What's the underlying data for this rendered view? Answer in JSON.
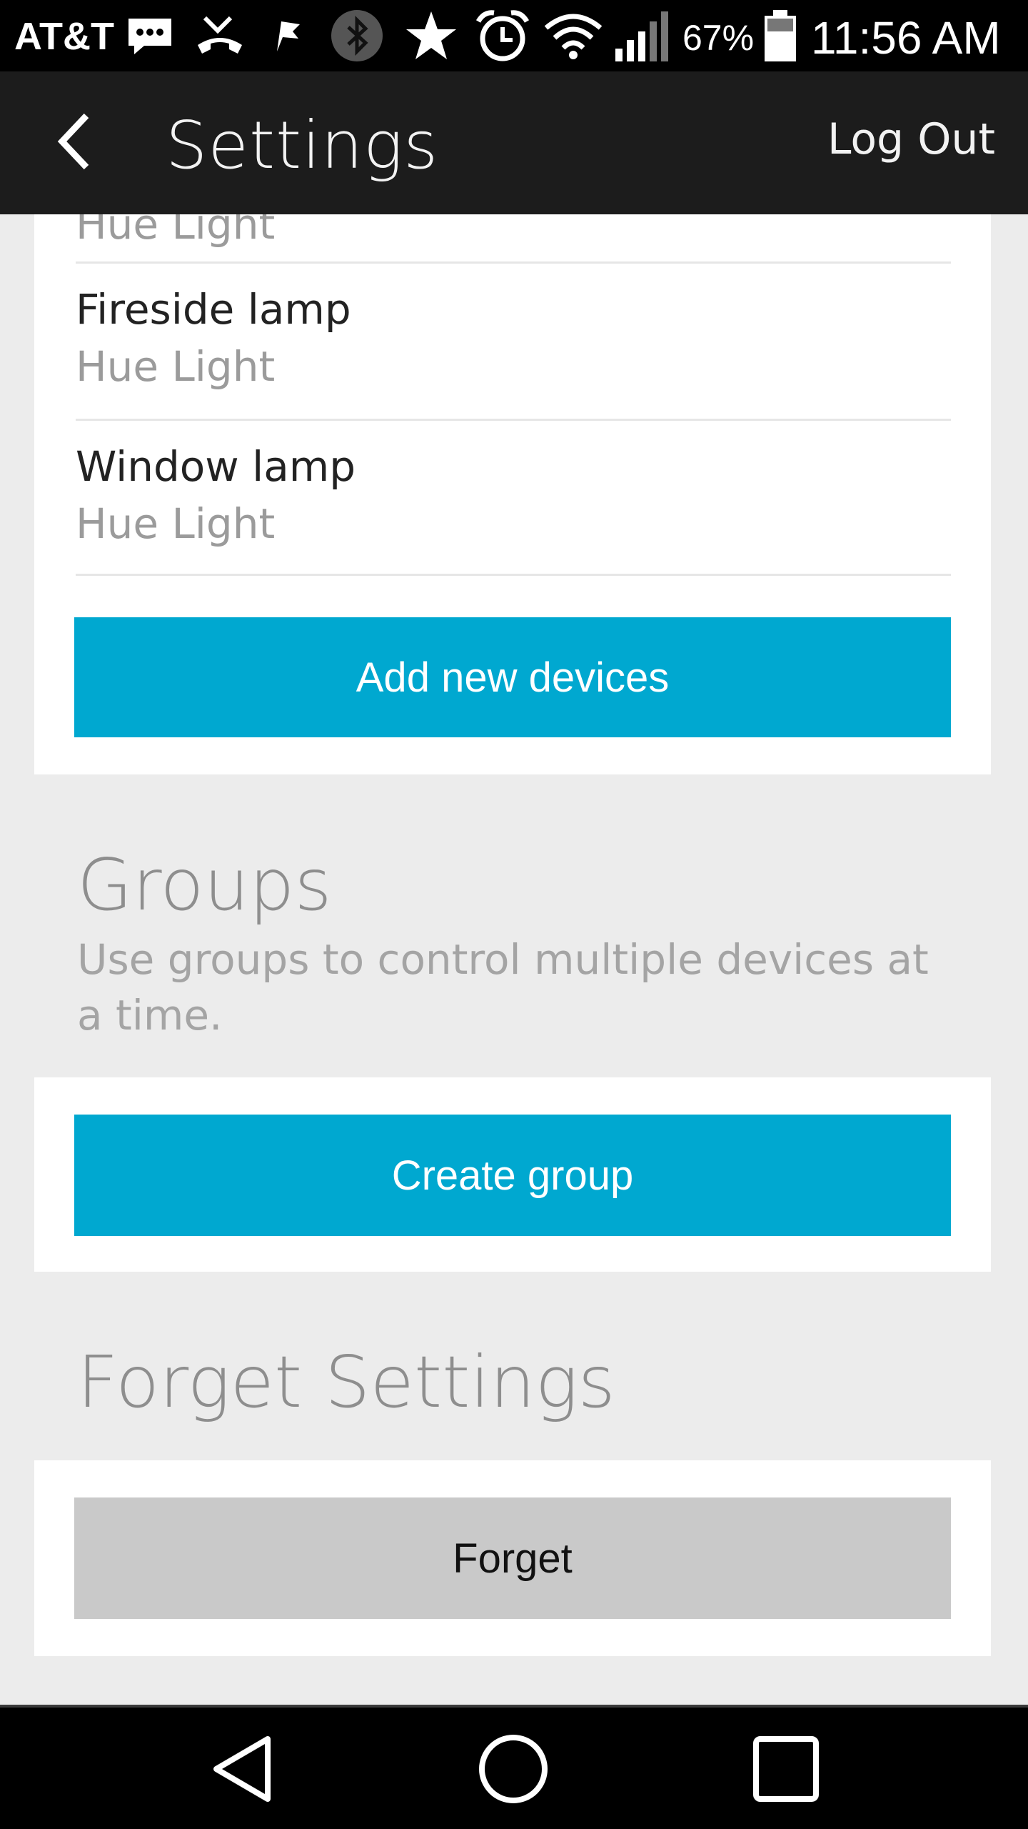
{
  "status_bar": {
    "carrier": "AT&T",
    "battery_percent": "67%",
    "time": "11:56 AM",
    "icons": [
      "message-icon",
      "missed-call-icon",
      "notification-flag-icon",
      "bluetooth-icon",
      "star-icon",
      "alarm-icon",
      "wifi-icon",
      "signal-icon",
      "battery-icon"
    ]
  },
  "app_bar": {
    "back_icon": "chevron-left-icon",
    "title": "Settings",
    "logout_label": "Log Out"
  },
  "devices": {
    "items": [
      {
        "name": "",
        "type": "Hue Light"
      },
      {
        "name": "Fireside lamp",
        "type": "Hue Light"
      },
      {
        "name": "Window lamp",
        "type": "Hue Light"
      }
    ],
    "add_button_label": "Add new devices"
  },
  "groups": {
    "title": "Groups",
    "description": "Use groups to control multiple devices at a time.",
    "create_button_label": "Create group"
  },
  "forget": {
    "title": "Forget Settings",
    "button_label": "Forget"
  },
  "nav_bar": {
    "icons": [
      "back-triangle-icon",
      "home-circle-icon",
      "recents-square-icon"
    ]
  },
  "colors": {
    "accent": "#00a8d0",
    "app_bar": "#1c1c1c",
    "background": "#ececec",
    "secondary_button": "#c9c9c9"
  }
}
